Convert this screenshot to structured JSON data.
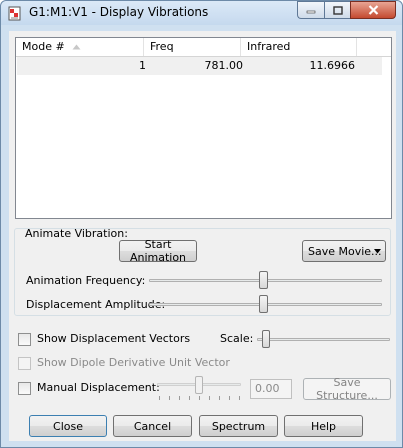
{
  "window": {
    "title": "G1:M1:V1 - Display Vibrations",
    "icon": "gaussview-doc-icon"
  },
  "list": {
    "columns": [
      "Mode #",
      "Freq",
      "Infrared"
    ],
    "sort_column": "Mode #",
    "sort_direction": "ascending",
    "rows": [
      {
        "mode": "1",
        "freq": "781.00",
        "infrared": "11.6966"
      }
    ]
  },
  "animation": {
    "label": "Animate Vibration:",
    "start_button": "Start Animation",
    "save_movie_button": "Save Movie...",
    "frequency_label": "Animation Frequency:",
    "amplitude_label": "Displacement Amplitude:",
    "frequency_level": 0.49,
    "amplitude_level": 0.49
  },
  "options": {
    "show_displacement_vectors": {
      "label": "Show Displacement Vectors",
      "checked": false
    },
    "scale_label": "Scale:",
    "scale_level": 0.04,
    "show_dipole": {
      "label": "Show Dipole Derivative Unit Vector",
      "checked": false,
      "enabled": false
    },
    "manual_displacement": {
      "label": "Manual Displacement:",
      "checked": false
    },
    "manual_level": 0.5,
    "displacement_value": "0.00",
    "save_structure_button": "Save Structure..."
  },
  "footer": {
    "close": "Close",
    "cancel": "Cancel",
    "spectrum": "Spectrum",
    "help": "Help"
  },
  "colors": {
    "frame": "#cfe0f0",
    "client": "#f0f0f0",
    "close_button": "#c44a30",
    "selection_row": "#f0f0f0"
  }
}
